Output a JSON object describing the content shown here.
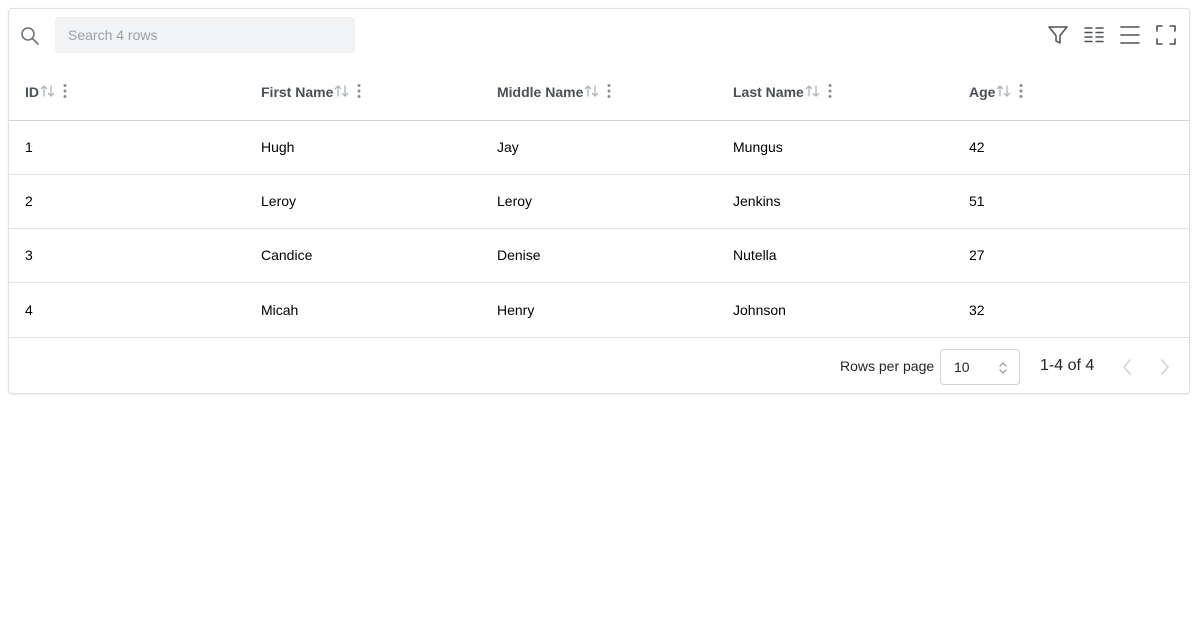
{
  "toolbar": {
    "search_placeholder": "Search 4 rows",
    "search_value": "",
    "icons": [
      "search-icon",
      "filter-icon",
      "columns-icon",
      "density-icon",
      "fullscreen-icon"
    ]
  },
  "table": {
    "columns": [
      {
        "label": "ID",
        "sortable": true
      },
      {
        "label": "First Name",
        "sortable": true
      },
      {
        "label": "Middle Name",
        "sortable": true
      },
      {
        "label": "Last Name",
        "sortable": true
      },
      {
        "label": "Age",
        "sortable": true
      }
    ],
    "rows": [
      [
        "1",
        "Hugh",
        "Jay",
        "Mungus",
        "42"
      ],
      [
        "2",
        "Leroy",
        "Leroy",
        "Jenkins",
        "51"
      ],
      [
        "3",
        "Candice",
        "Denise",
        "Nutella",
        "27"
      ],
      [
        "4",
        "Micah",
        "Henry",
        "Johnson",
        "32"
      ]
    ]
  },
  "footer": {
    "rows_per_page_label": "Rows per page",
    "rows_per_page_value": "10",
    "page_info": "1-4 of 4"
  },
  "colors": {
    "icon": "#495057",
    "icon_muted": "#adb5bd",
    "border": "#dee2e6",
    "search_bg": "#f1f3f5"
  }
}
